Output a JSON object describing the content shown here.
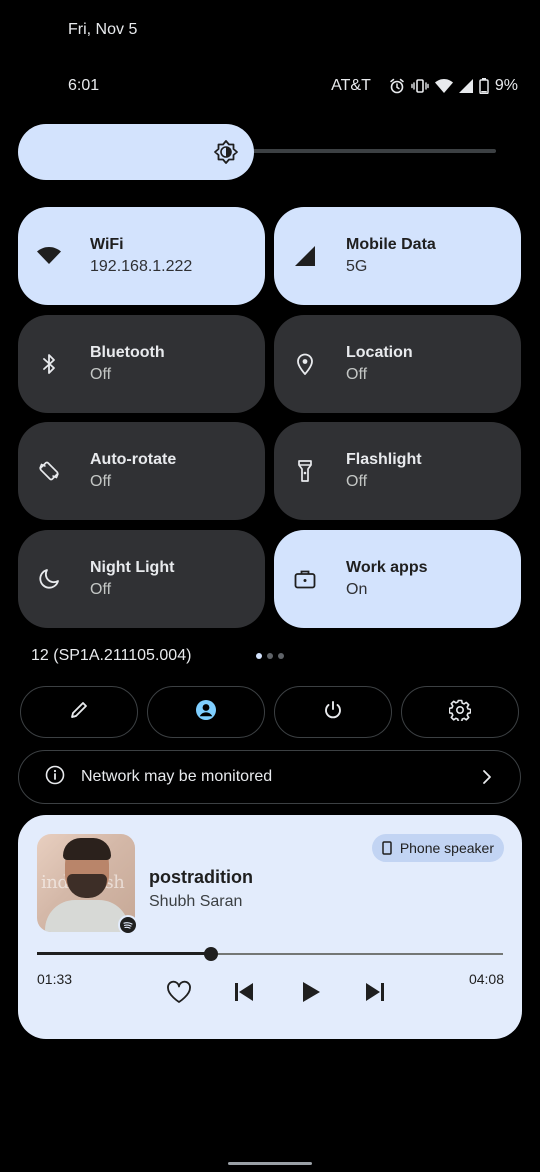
{
  "status": {
    "date": "Fri, Nov 5",
    "time": "6:01",
    "carrier": "AT&T",
    "battery": "9%"
  },
  "brightness": {
    "level": 0.43
  },
  "tiles": [
    {
      "label": "WiFi",
      "sub": "192.168.1.222",
      "icon": "wifi-icon",
      "state": "on"
    },
    {
      "label": "Mobile Data",
      "sub": "5G",
      "icon": "cell-signal-icon",
      "state": "on"
    },
    {
      "label": "Bluetooth",
      "sub": "Off",
      "icon": "bluetooth-icon",
      "state": "off"
    },
    {
      "label": "Location",
      "sub": "Off",
      "icon": "location-pin-icon",
      "state": "off"
    },
    {
      "label": "Auto-rotate",
      "sub": "Off",
      "icon": "rotate-icon",
      "state": "off"
    },
    {
      "label": "Flashlight",
      "sub": "Off",
      "icon": "flashlight-icon",
      "state": "off"
    },
    {
      "label": "Night Light",
      "sub": "Off",
      "icon": "moon-icon",
      "state": "off"
    },
    {
      "label": "Work apps",
      "sub": "On",
      "icon": "briefcase-icon",
      "state": "on"
    }
  ],
  "build": "12 (SP1A.211105.004)",
  "page_dots": {
    "count": 3,
    "active": 0
  },
  "controls": [
    "edit-icon",
    "user-icon",
    "power-icon",
    "settings-icon"
  ],
  "network": {
    "text": "Network may be monitored"
  },
  "media": {
    "song": "postradition",
    "artist": "Shubh Saran",
    "output": "Phone speaker",
    "elapsed": "01:33",
    "total": "04:08",
    "progress": 0.374,
    "art_text": "indalleish"
  },
  "colors": {
    "tile_on": "#d3e3fd",
    "tile_off": "#303134",
    "media_bg": "#e3ecfc",
    "accent": "#7fcfff"
  }
}
